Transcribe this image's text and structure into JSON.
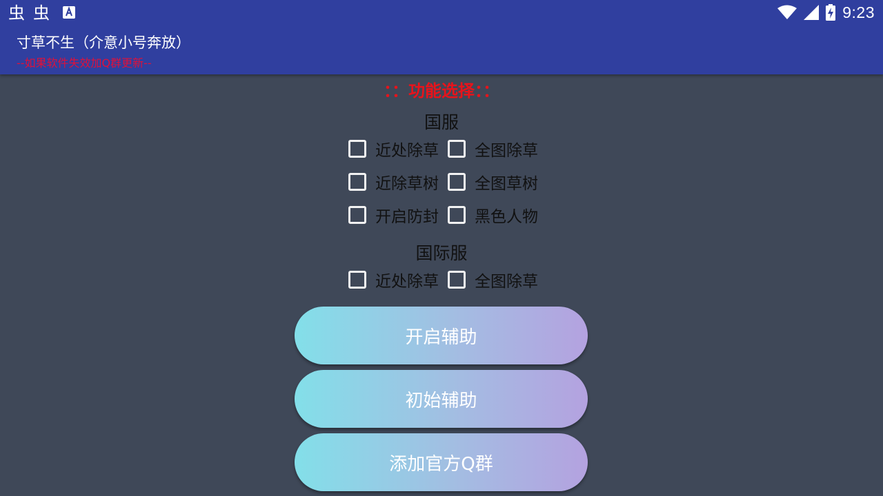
{
  "status_bar": {
    "time": "9:23",
    "left_icons": [
      "bug-icon",
      "bug-icon",
      "a-notification-icon"
    ],
    "right_icons": [
      "wifi-icon",
      "signal-icon",
      "battery-charging-icon"
    ]
  },
  "app_bar": {
    "title": "寸草不生（介意小号奔放）",
    "subtitle": "--如果软件失效加Q群更新--",
    "background": "#303f9f",
    "subtitle_color": "#e0103a"
  },
  "main": {
    "heading": "：：功能选择：：",
    "heading_color": "#e8131b",
    "groups": [
      {
        "label": "国服",
        "options": [
          {
            "label": "近处除草",
            "checked": false
          },
          {
            "label": "全图除草",
            "checked": false
          },
          {
            "label": "近除草树",
            "checked": false
          },
          {
            "label": "全图草树",
            "checked": false
          },
          {
            "label": "开启防封",
            "checked": false
          },
          {
            "label": "黑色人物",
            "checked": false
          }
        ]
      },
      {
        "label": "国际服",
        "options": [
          {
            "label": "近处除草",
            "checked": false
          },
          {
            "label": "全图除草",
            "checked": false
          }
        ]
      }
    ],
    "buttons": [
      {
        "label": "开启辅助"
      },
      {
        "label": "初始辅助"
      },
      {
        "label": "添加官方Q群"
      }
    ],
    "background": "#3f4858"
  }
}
